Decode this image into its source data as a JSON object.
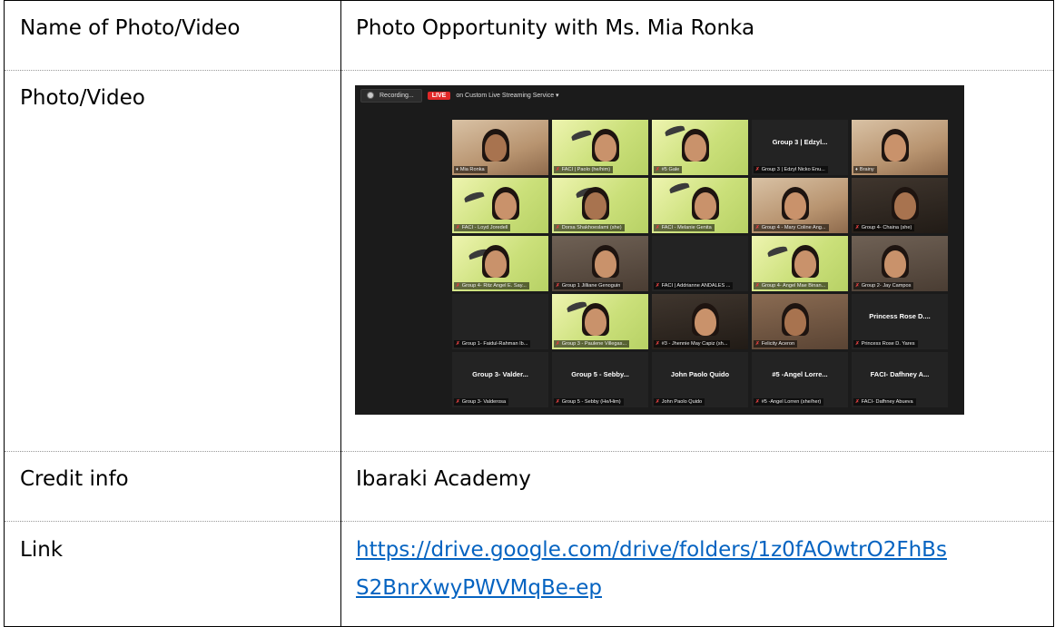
{
  "table": {
    "rows": [
      {
        "label": "Name of Photo/Video",
        "value": "Photo Opportunity with Ms. Mia Ronka"
      },
      {
        "label": "Photo/Video"
      },
      {
        "label": "Credit info",
        "value": "Ibaraki Academy"
      },
      {
        "label": "Link",
        "value_line1": "https://drive.google.com/drive/folders/1z0fAOwtrO2FhBs",
        "value_line2": "S2BnrXwyPWVMqBe-ep"
      }
    ]
  },
  "screenshot": {
    "recording_label": "Recording...",
    "live_badge": "LIVE",
    "stream_label": "on Custom Live Streaming Service ▾",
    "participants": [
      {
        "name": "Mia Ronka",
        "style": "warm",
        "muted": false
      },
      {
        "name": "FACI | Paolo (he/him)",
        "style": "green",
        "muted": true
      },
      {
        "name": "#5 Gale",
        "style": "green",
        "muted": true
      },
      {
        "name": "Group 3 | Edzyl Nicko Enu...",
        "display": "Group 3 | Edzyl...",
        "style": "dark",
        "muted": true
      },
      {
        "name": "Brainy",
        "style": "warm",
        "muted": false
      },
      {
        "name": "FACI - Loyd Joredell",
        "style": "green",
        "muted": true
      },
      {
        "name": "Dorsa Shakhoeslami (she)",
        "style": "green",
        "muted": true
      },
      {
        "name": "FACI - Melanie Genita",
        "style": "green",
        "muted": true
      },
      {
        "name": "Group 4 - Mary Coline Ang...",
        "style": "warm",
        "muted": true
      },
      {
        "name": "Group 4- Chaina (she)",
        "style": "night",
        "muted": true
      },
      {
        "name": "Group 4- Ritz Angel E. Say...",
        "style": "green",
        "muted": true
      },
      {
        "name": "Group 1 Jilliane Genoguin",
        "style": "room",
        "muted": true
      },
      {
        "name": "FACI | Addrianne ANDALES ...",
        "style": "dark",
        "muted": true
      },
      {
        "name": "Group 4- Angel Mae Binan...",
        "style": "green",
        "muted": true
      },
      {
        "name": "Group 2- Jay Campos",
        "style": "room",
        "muted": true
      },
      {
        "name": "Group 1- Faidul-Rahman Ib...",
        "style": "dark",
        "muted": true
      },
      {
        "name": "Group 3 - Paulene Villegas...",
        "style": "green",
        "muted": true
      },
      {
        "name": "#3 - Jhennie May Capiz (sh...",
        "style": "night",
        "muted": true
      },
      {
        "name": "Felicity Aceron",
        "style": "brown",
        "muted": true
      },
      {
        "name": "Princess Rose D. Yares",
        "display": "Princess Rose D....",
        "style": "dark",
        "muted": true
      },
      {
        "name": "Group 3- Valderosa",
        "display": "Group 3- Valder...",
        "style": "dark",
        "muted": true
      },
      {
        "name": "Group 5 - Sebby (He/Him)",
        "display": "Group 5 - Sebby...",
        "style": "dark",
        "muted": true
      },
      {
        "name": "John Paolo Quido",
        "display": "John Paolo Quido",
        "style": "dark",
        "muted": true
      },
      {
        "name": "#5 -Angel Lorren (she/her)",
        "display": "#5 -Angel Lorre...",
        "style": "dark",
        "muted": true
      },
      {
        "name": "FACI- Dafhney Abueva",
        "display": "FACI- Dafhney A...",
        "style": "dark",
        "muted": true
      }
    ]
  }
}
